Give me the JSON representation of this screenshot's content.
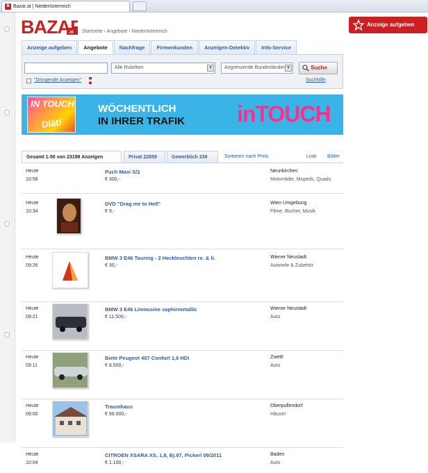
{
  "browser": {
    "tab_title": "Bazar.at | Niederösterreich",
    "favicon_letter": "B"
  },
  "header": {
    "logo_text": "BAZAR",
    "logo_suffix": ".at",
    "breadcrumb": "Startseite › Angebote › Niederösterreich",
    "cta_label": "Anzeige aufgeben"
  },
  "nav": {
    "tabs": [
      {
        "label": "Anzeige aufgeben"
      },
      {
        "label": "Angebote",
        "active": true
      },
      {
        "label": "Nachfrage"
      },
      {
        "label": "Firmenkunden"
      },
      {
        "label": "Anzeigen-Detektiv"
      },
      {
        "label": "Info-Service"
      }
    ]
  },
  "search": {
    "query_value": "",
    "category_value": "Alle Rubriken",
    "region_value": "Angrenzende Bundesländer",
    "button_label": "Suche",
    "checkbox_label": "\"Dringende Anzeigen\"",
    "help_link": "Suchhilfe"
  },
  "banner": {
    "mag_top": "IN TOUCH",
    "mag_bottom": "Diät!",
    "line1": "WÖCHENTLICH",
    "line2": "IN IHRER TRAFIK",
    "brand": "inTOUCH"
  },
  "results_tabs": {
    "total": "Gesamt 1-50 von 23198 Anzeigen",
    "private": "Privat 22859",
    "commercial": "Gewerblich 339",
    "sort": "Sortieren nach Preis",
    "view_list": "Liste",
    "view_images": "Bilder"
  },
  "listings": [
    {
      "day": "Heute",
      "time": "10:58",
      "title": "Puch Maxi S/2",
      "price": "€ 300,-",
      "location": "Neunkirchen",
      "category": "Motorräder, Mopeds, Quads",
      "thumb": ""
    },
    {
      "day": "Heute",
      "time": "10:34",
      "title": "DVD \"Drag me to Hell\"",
      "price": "€ 9,-",
      "location": "Wien-Umgebung",
      "category": "Filme, Bücher, Musik",
      "thumb": "dvd"
    },
    {
      "day": "Heute",
      "time": "09:26",
      "title": "BMW 3 E46 Touring - 2 Heckleuchten re. & li.",
      "price": "€ 30,-",
      "location": "Wiener Neustadt",
      "category": "Autoteile & Zubehör",
      "thumb": "lamp"
    },
    {
      "day": "Heute",
      "time": "09:21",
      "title": "BMW 3 E46 Limousine saphirmetallic",
      "price": "€ 11.500,-",
      "location": "Wiener Neustadt",
      "category": "Auto",
      "thumb": "car-dark"
    },
    {
      "day": "Heute",
      "time": "09:11",
      "title": "Biete Peugeot 407 Confort 1,6 HDI",
      "price": "€ 8.500,-",
      "location": "Zwettl",
      "category": "Auto",
      "thumb": "car-silver"
    },
    {
      "day": "Heute",
      "time": "09:00",
      "title": "Traumhaus",
      "price": "€ 99.000,-",
      "location": "Oberpullendorf",
      "category": "Häuser",
      "thumb": "house"
    },
    {
      "day": "Heute",
      "time": "10:04",
      "title": "CITROEN XSARA XS, 1,8, Bj.97, Pickerl 09/2011",
      "price": "€ 1.100,-",
      "location": "Baden",
      "category": "Auto",
      "thumb": ""
    }
  ],
  "colors": {
    "brand_red": "#cc1f24",
    "link_blue": "#2c5fa8",
    "banner_blue": "#3ab3e6",
    "banner_pink": "#ff2e8b"
  }
}
